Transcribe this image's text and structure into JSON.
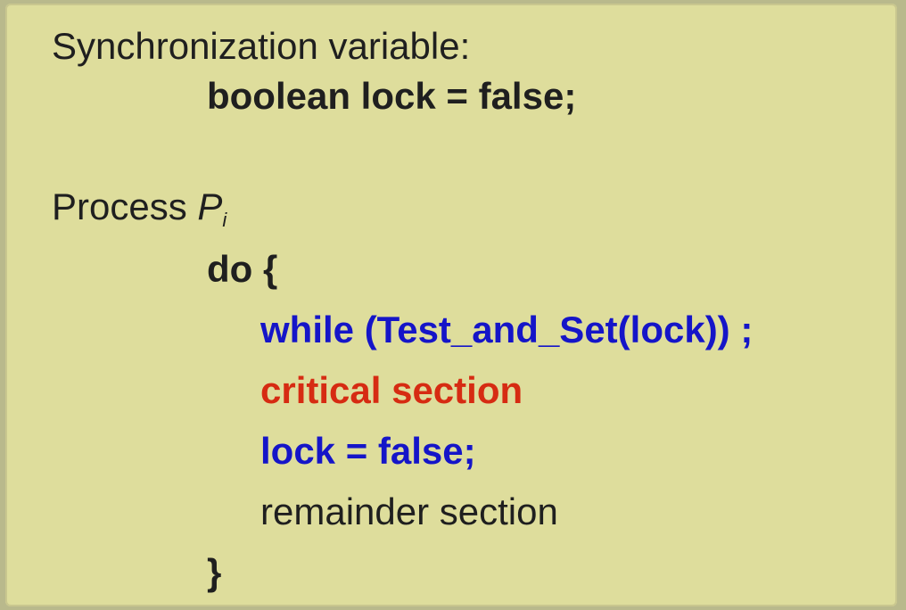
{
  "colors": {
    "background": "#dedd9c",
    "text": "#1f1f1f",
    "blue": "#1515c8",
    "red": "#d62b12"
  },
  "slide": {
    "sync_label": "Synchronization variable:",
    "lock_decl": "boolean lock = false;",
    "process_label": "Process",
    "process_name": "P",
    "process_subscript": "i",
    "do_open": "do {",
    "while_line": "while (Test_and_Set(lock)) ;",
    "critical_section": "critical section",
    "lock_release": "lock = false;",
    "remainder_section": "remainder section",
    "close_brace": "}"
  }
}
